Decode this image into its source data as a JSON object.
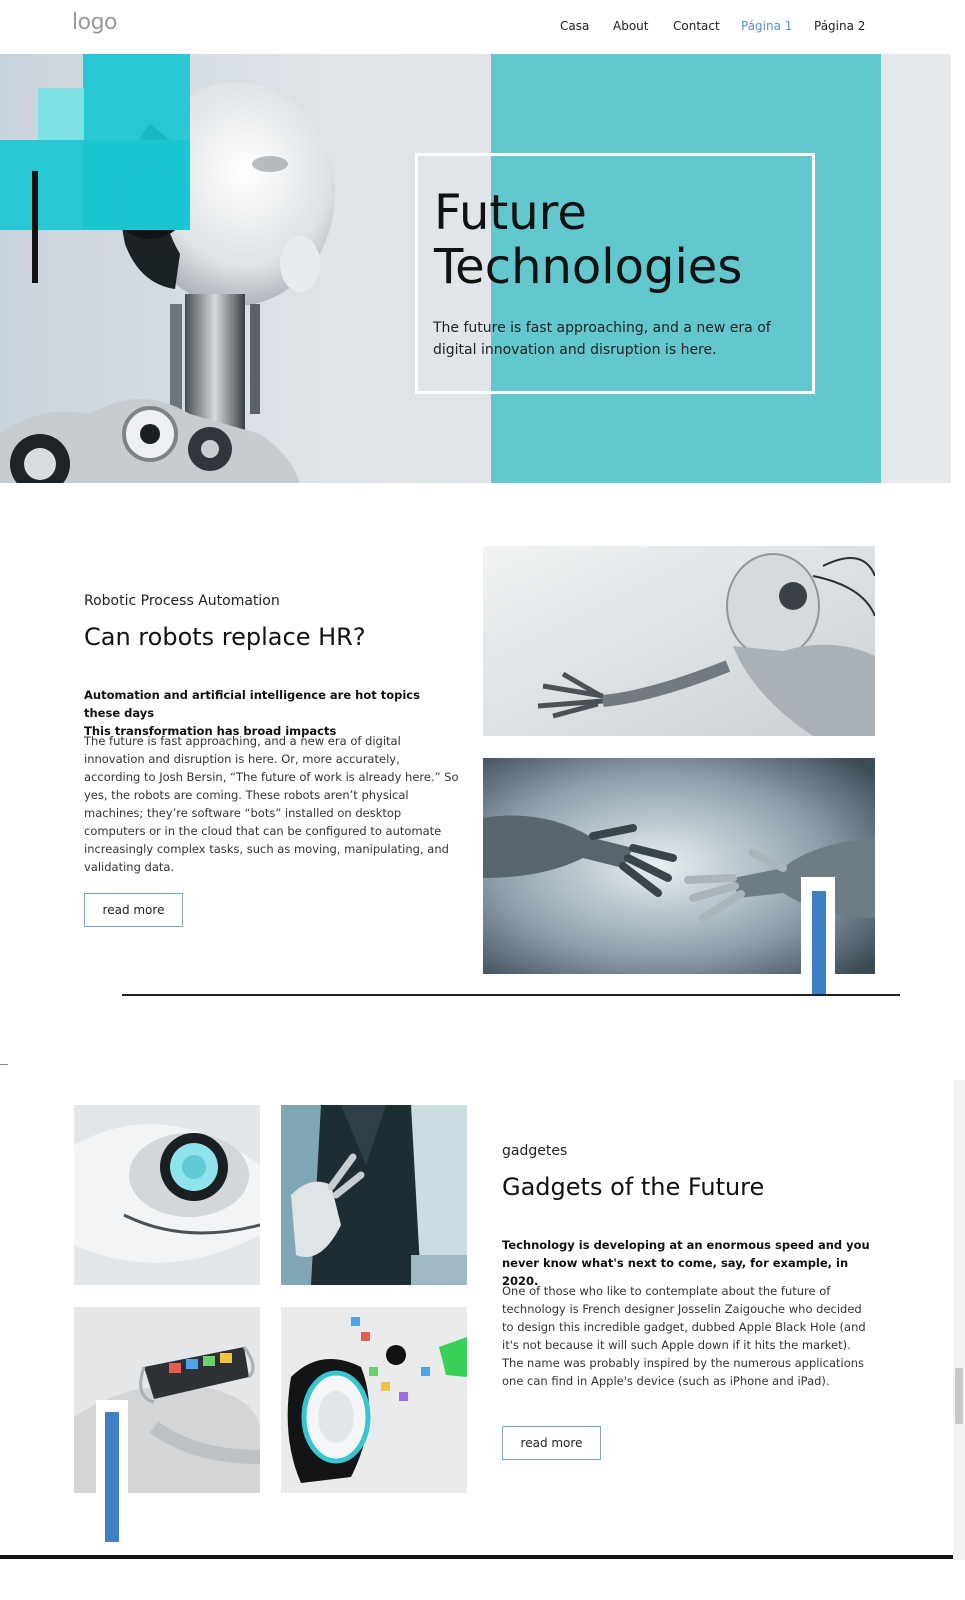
{
  "header": {
    "logo": "logo",
    "nav": [
      {
        "label": "Casa"
      },
      {
        "label": "About"
      },
      {
        "label": "Contact"
      },
      {
        "label": "Página 1",
        "active": true
      },
      {
        "label": "Página 2"
      }
    ]
  },
  "hero": {
    "title_line1": "Future",
    "title_line2": "Technologies",
    "text": "The future is fast approaching, and a new era of digital innovation and disruption is here."
  },
  "section1": {
    "eyebrow": "Robotic Process Automation",
    "title": "Can robots replace HR?",
    "lead_line1": "Automation and artificial intelligence are hot topics these days",
    "lead_line2": "This transformation has broad impacts",
    "body": "The future is fast approaching, and a new era of digital innovation and disruption is here. Or, more accurately, according to Josh Bersin, “The future of work is already here.” So yes, the robots are coming. These robots aren’t physical machines; they’re software “bots” installed on desktop computers or in the cloud that can be configured to automate increasingly complex tasks, such as moving, manipulating, and validating data.",
    "button": "read more"
  },
  "section2": {
    "eyebrow": "gadgetes",
    "title": "Gadgets of the Future",
    "lead": "Technology is developing at an enormous speed and you never know what's next to come, say, for example, in 2020.",
    "body": "One of those who like to contemplate about the future of technology is French designer Josselin Zaigouche who decided to design this incredible gadget, dubbed Apple Black Hole (and it's not because it will such Apple down if it hits the market). The name was probably inspired by the numerous applications one can find in Apple's device (such as iPhone and iPad).",
    "button": "read more"
  },
  "colors": {
    "accent_teal": "#63c8cd",
    "accent_cyan": "#1ac6d2",
    "accent_blue": "#3f7fc4",
    "nav_active": "#5b8ec8"
  }
}
